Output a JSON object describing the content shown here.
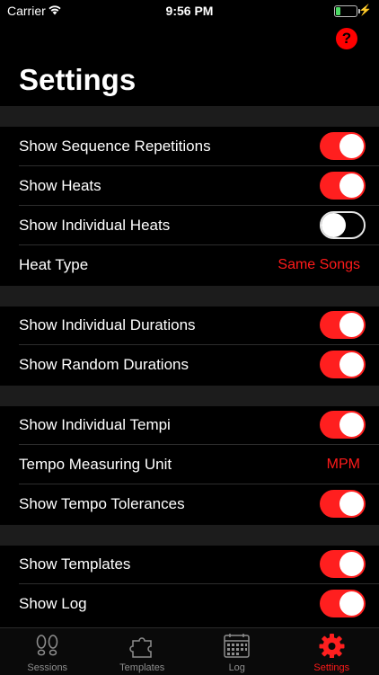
{
  "status_bar": {
    "carrier": "Carrier",
    "time": "9:56 PM",
    "bolt": "⚡"
  },
  "help_button": {
    "label": "?",
    "icon": "question-icon"
  },
  "page_title": "Settings",
  "colors": {
    "accent": "#ff1f1f",
    "background": "#000000",
    "separator": "#1c1c1c"
  },
  "rows": [
    {
      "label": "Show Sequence Repetitions",
      "toggle": true
    },
    {
      "label": "Show Heats",
      "toggle": true
    },
    {
      "label": "Show Individual Heats",
      "toggle": false
    },
    {
      "label": "Heat Type",
      "value": "Same Songs"
    },
    {
      "label": "Show Individual Durations",
      "toggle": true
    },
    {
      "label": "Show Random Durations",
      "toggle": true
    },
    {
      "label": "Show Individual Tempi",
      "toggle": true
    },
    {
      "label": "Tempo Measuring Unit",
      "value": "MPM"
    },
    {
      "label": "Show Tempo Tolerances",
      "toggle": true
    },
    {
      "label": "Show Templates",
      "toggle": true
    },
    {
      "label": "Show Log",
      "toggle": true
    }
  ],
  "tabs": [
    {
      "label": "Sessions",
      "icon": "footprints-icon",
      "active": false
    },
    {
      "label": "Templates",
      "icon": "puzzle-icon",
      "active": false
    },
    {
      "label": "Log",
      "icon": "calendar-icon",
      "active": false
    },
    {
      "label": "Settings",
      "icon": "gear-icon",
      "active": true
    }
  ]
}
